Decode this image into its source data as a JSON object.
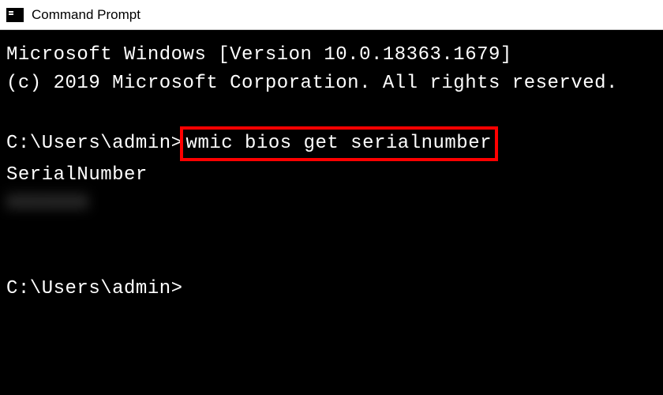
{
  "titlebar": {
    "title": "Command Prompt"
  },
  "terminal": {
    "header_line1": "Microsoft Windows [Version 10.0.18363.1679]",
    "header_line2": "(c) 2019 Microsoft Corporation. All rights reserved.",
    "prompt1_path": "C:\\Users\\admin>",
    "command": "wmic bios get serialnumber",
    "output_header": "SerialNumber",
    "output_value": "XXXXXXX",
    "prompt2_path": "C:\\Users\\admin>"
  }
}
